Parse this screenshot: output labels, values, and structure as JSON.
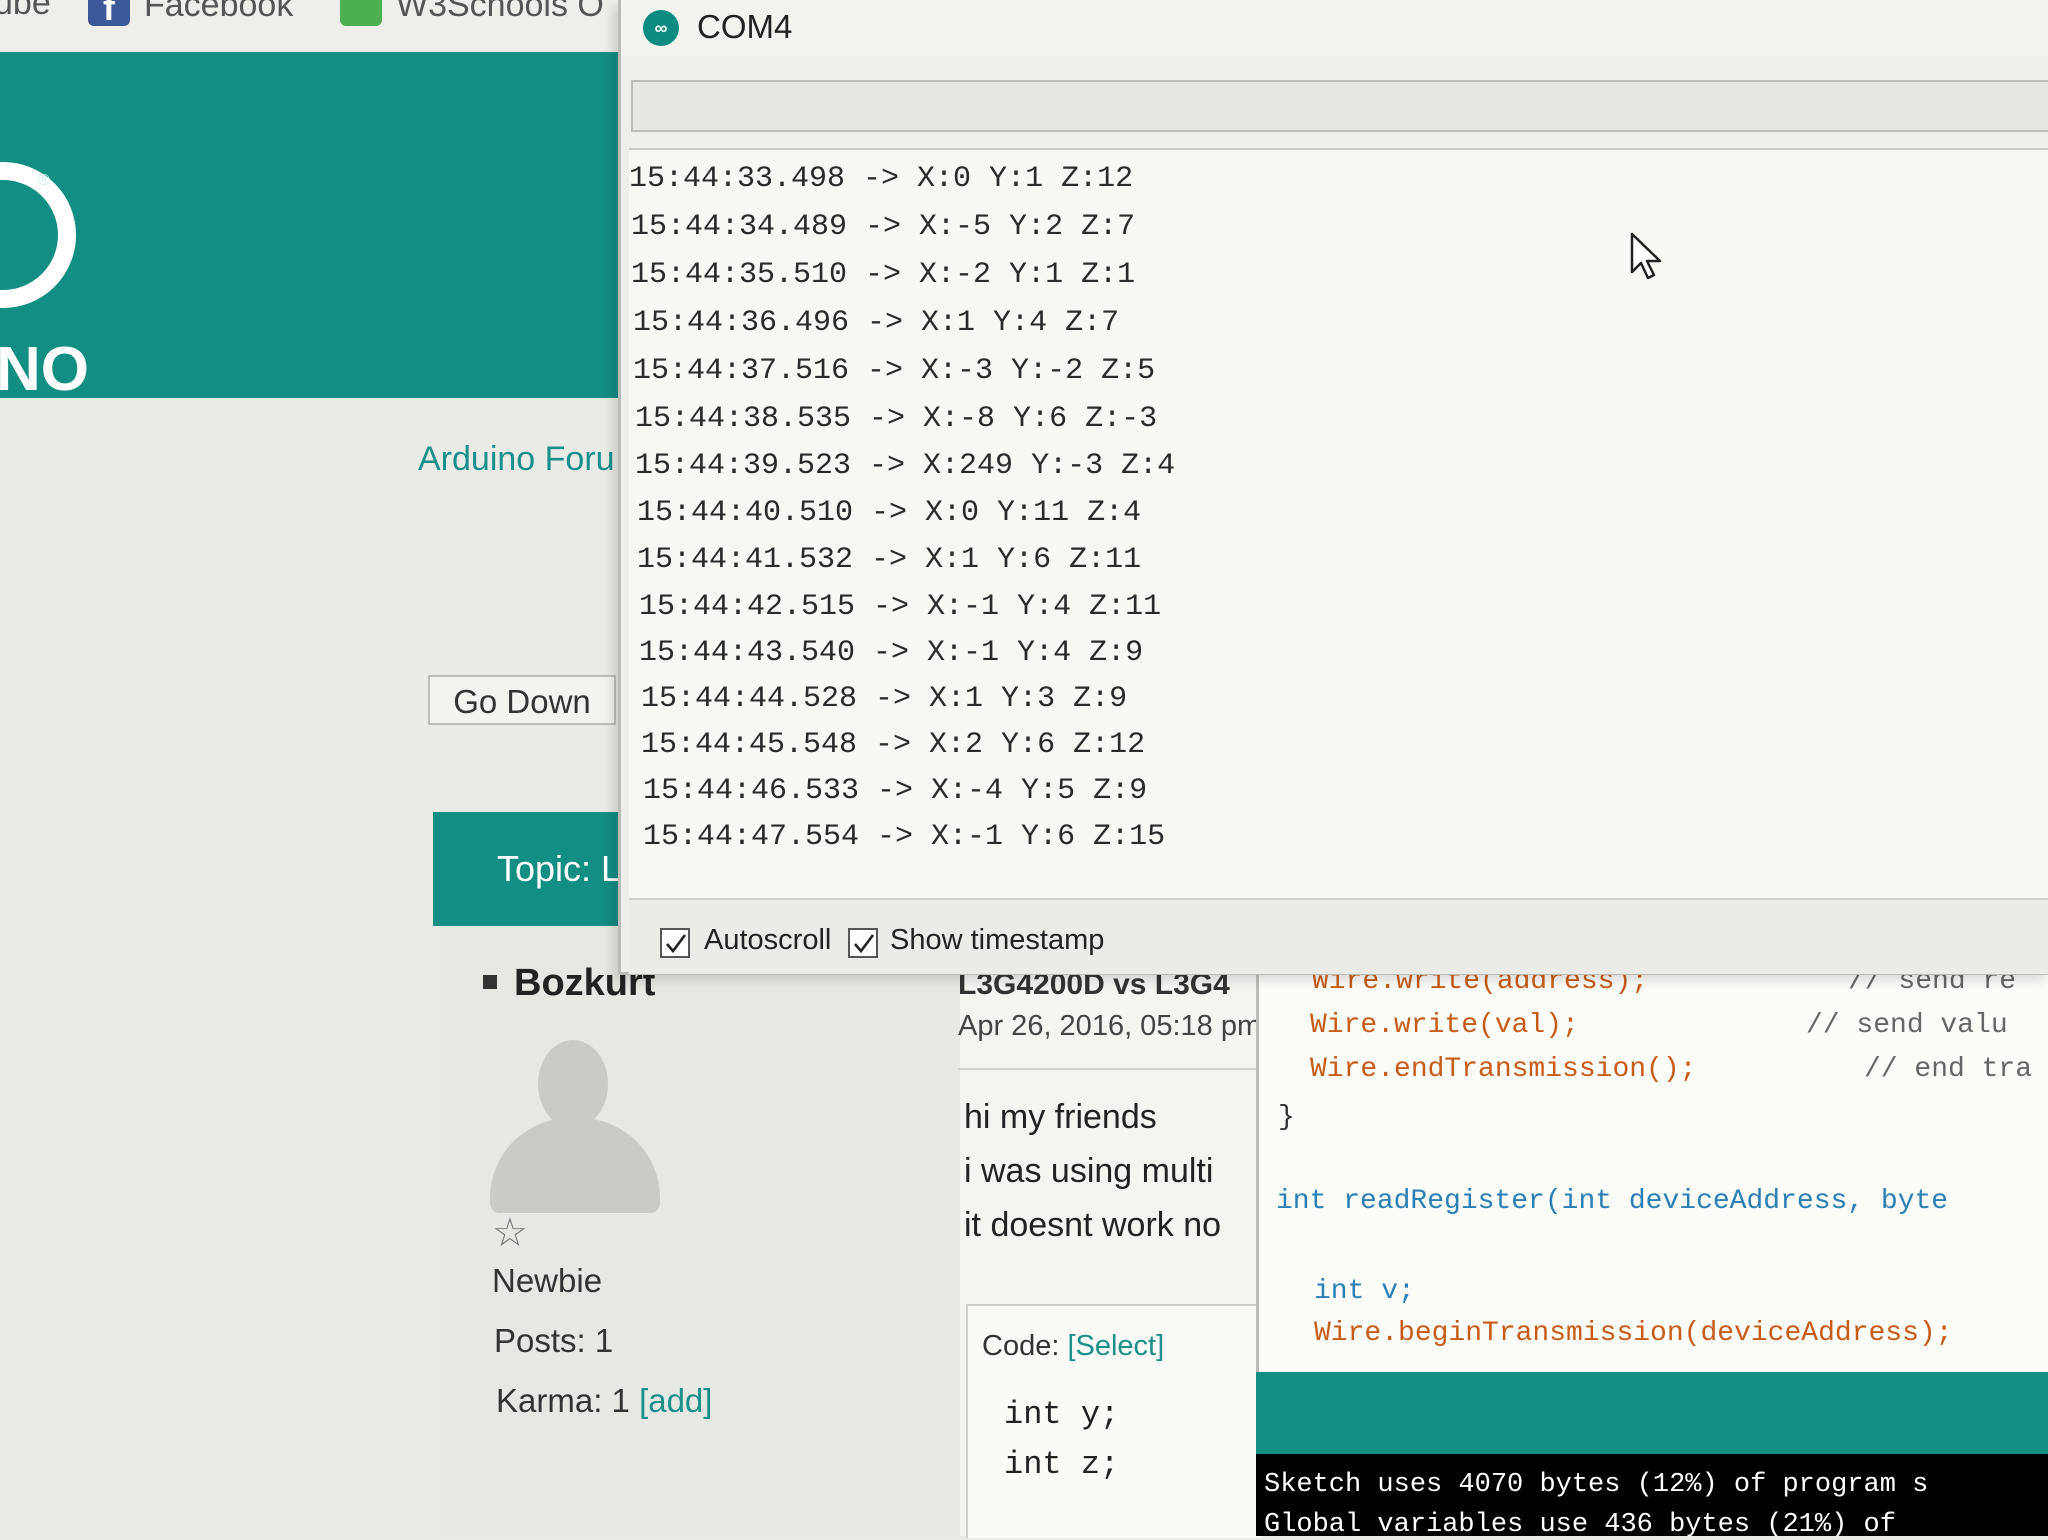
{
  "browser": {
    "bookmarks": [
      {
        "label": "ube",
        "icon": "youtube-icon"
      },
      {
        "label": "Facebook",
        "icon": "facebook-icon"
      },
      {
        "label": "W3Schools O",
        "icon": "w3schools-icon"
      }
    ]
  },
  "forum": {
    "logo_text": "NO",
    "logo_reg": "®",
    "breadcrumb": "Arduino Foru",
    "go_down_label": "Go Down",
    "topic_label": "Topic: L",
    "user": {
      "name": "Bozkurt",
      "rank": "Newbie",
      "posts": "Posts: 1",
      "karma": "Karma: 1",
      "karma_add": "[add]"
    },
    "post": {
      "title": "L3G4200D vs L3G4",
      "date": "Apr 26, 2016, 05:18 pm",
      "lines": [
        "hi my friends",
        "i was using multi",
        "it doesnt work no"
      ],
      "code_label": "Code:",
      "code_select": "[Select]",
      "code_lines": [
        "int y;",
        "int z;"
      ]
    }
  },
  "ide_editor": {
    "lines": [
      {
        "code": "Wire.write(address);",
        "comment": "// send re"
      },
      {
        "code": "Wire.write(val);",
        "comment": "// send valu"
      },
      {
        "code": "Wire.endTransmission();",
        "comment": "// end tra"
      },
      {
        "code": "}",
        "comment": ""
      },
      {
        "code": "int readRegister(int deviceAddress, byte",
        "comment": ""
      },
      {
        "code": "int v;",
        "comment": ""
      },
      {
        "code": "Wire.beginTransmission(deviceAddress);",
        "comment": ""
      }
    ],
    "console": [
      "Sketch uses 4070 bytes (12%) of program s",
      "Global variables use 436 bytes (21%) of"
    ]
  },
  "serial_monitor": {
    "title": "COM4",
    "app_icon": "arduino-icon",
    "send_input_value": "",
    "output_lines": [
      "15:44:33.498 -> X:0 Y:1 Z:12",
      "15:44:34.489 -> X:-5 Y:2 Z:7",
      "15:44:35.510 -> X:-2 Y:1 Z:1",
      "15:44:36.496 -> X:1 Y:4 Z:7",
      "15:44:37.516 -> X:-3 Y:-2 Z:5",
      "15:44:38.535 -> X:-8 Y:6 Z:-3",
      "15:44:39.523 -> X:249 Y:-3 Z:4",
      "15:44:40.510 -> X:0 Y:11 Z:4",
      "15:44:41.532 -> X:1 Y:6 Z:11",
      "15:44:42.515 -> X:-1 Y:4 Z:11",
      "15:44:43.540 -> X:-1 Y:4 Z:9",
      "15:44:44.528 -> X:1 Y:3 Z:9",
      "15:44:45.548 -> X:2 Y:6 Z:12",
      "15:44:46.533 -> X:-4 Y:5 Z:9",
      "15:44:47.554 -> X:-1 Y:6 Z:15"
    ],
    "autoscroll": {
      "label": "Autoscroll",
      "checked": true
    },
    "show_timestamp": {
      "label": "Show timestamp",
      "checked": true
    }
  },
  "colors": {
    "arduino_teal": "#138e83",
    "link_teal": "#1b8f8a",
    "keyword_orange": "#c75c19",
    "type_blue": "#2a7fb5"
  }
}
